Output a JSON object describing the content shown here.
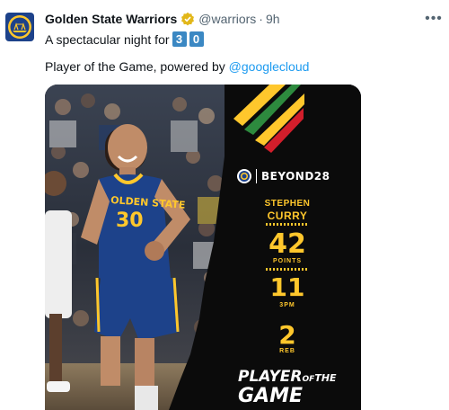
{
  "tweet": {
    "display_name": "Golden State Warriors",
    "handle": "@warriors",
    "separator": "·",
    "time": "9h",
    "line1_text": "A spectacular night for",
    "keycap_digits": [
      "3",
      "0"
    ],
    "line2_text": "Player of the Game, powered by ",
    "line2_mention": "@googlecloud",
    "more_icon": "•••"
  },
  "graphic": {
    "brand": "BEYOND28",
    "first_name": "STEPHEN",
    "last_name": "CURRY",
    "points_value": "42",
    "points_label": "POINTS",
    "threes_value": "11",
    "threes_label": "3PM",
    "rebounds_value": "2",
    "rebounds_label": "REB",
    "title_word1": "PLAYER",
    "title_of": "OF",
    "title_the": "THE",
    "title_word2": "GAME",
    "jersey_text": "OLDEN STATE",
    "jersey_number": "30"
  },
  "colors": {
    "warriors_blue": "#1d428a",
    "warriors_gold": "#ffc72c",
    "link": "#1d9bf0",
    "verified_gold": "#e2b719",
    "keycap": "#3b88c3"
  }
}
